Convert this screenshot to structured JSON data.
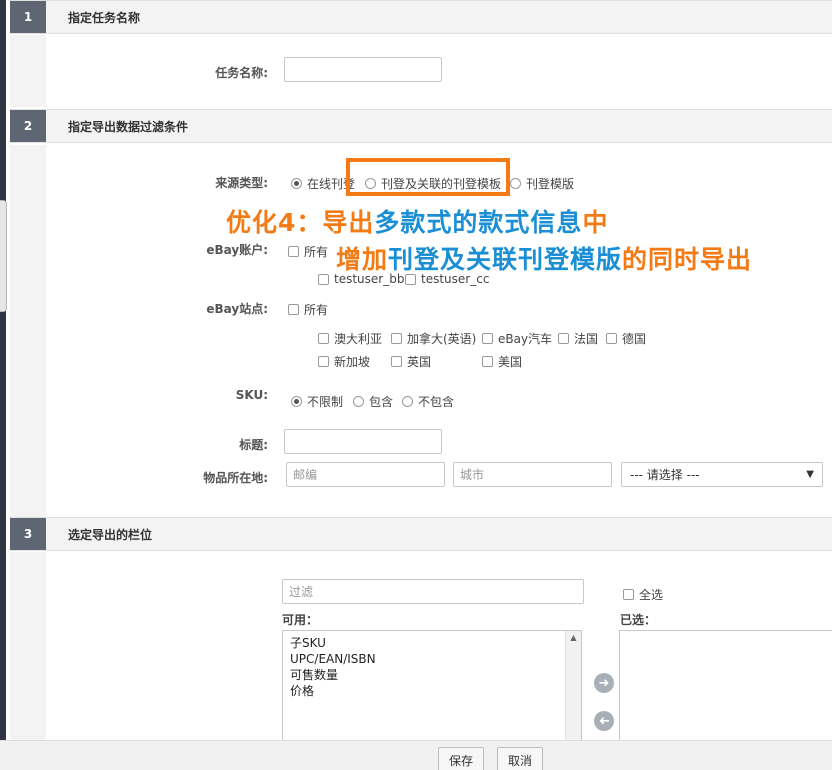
{
  "sections": [
    {
      "num": "1",
      "title": "指定任务名称"
    },
    {
      "num": "2",
      "title": "指定导出数据过滤条件"
    },
    {
      "num": "3",
      "title": "选定导出的栏位"
    }
  ],
  "task": {
    "label": "任务名称:",
    "value": ""
  },
  "source": {
    "label": "来源类型:",
    "options": [
      "在线刊登",
      "刊登及关联的刊登模板",
      "刊登模版"
    ],
    "selected": 0
  },
  "annotation": {
    "line1": [
      {
        "text": "优化4：",
        "color": "orange"
      },
      {
        "text": "导出",
        "color": "orange"
      },
      {
        "text": "多款式的款式信息",
        "color": "blue"
      },
      {
        "text": "中",
        "color": "orange"
      }
    ],
    "line2": [
      {
        "text": "增加",
        "color": "orange"
      },
      {
        "text": "刊登及关联刊登模版",
        "color": "blue"
      },
      {
        "text": "的同时导出",
        "color": "orange"
      }
    ]
  },
  "ebay_account": {
    "label": "eBay账户:",
    "all": "所有",
    "accounts": [
      "testuser_bb",
      "testuser_cc"
    ]
  },
  "ebay_site": {
    "label": "eBay站点:",
    "all": "所有",
    "row1": [
      "澳大利亚",
      "加拿大(英语)",
      "eBay汽车",
      "法国",
      "德国"
    ],
    "row2": [
      "新加坡",
      "英国",
      "美国"
    ]
  },
  "sku": {
    "label": "SKU:",
    "options": [
      "不限制",
      "包含",
      "不包含"
    ],
    "selected": 0
  },
  "title_field": {
    "label": "标题:",
    "value": ""
  },
  "location": {
    "label": "物品所在地:",
    "postal_placeholder": "邮编",
    "city_placeholder": "城市",
    "select_value": "--- 请选择 ---"
  },
  "columns": {
    "filter_placeholder": "过滤",
    "select_all": "全选",
    "available_label": "可用：",
    "selected_label": "已选：",
    "available": [
      "子SKU",
      "UPC/EAN/ISBN",
      "可售数量",
      "价格"
    ]
  },
  "footer": {
    "save": "保存",
    "cancel": "取消"
  }
}
